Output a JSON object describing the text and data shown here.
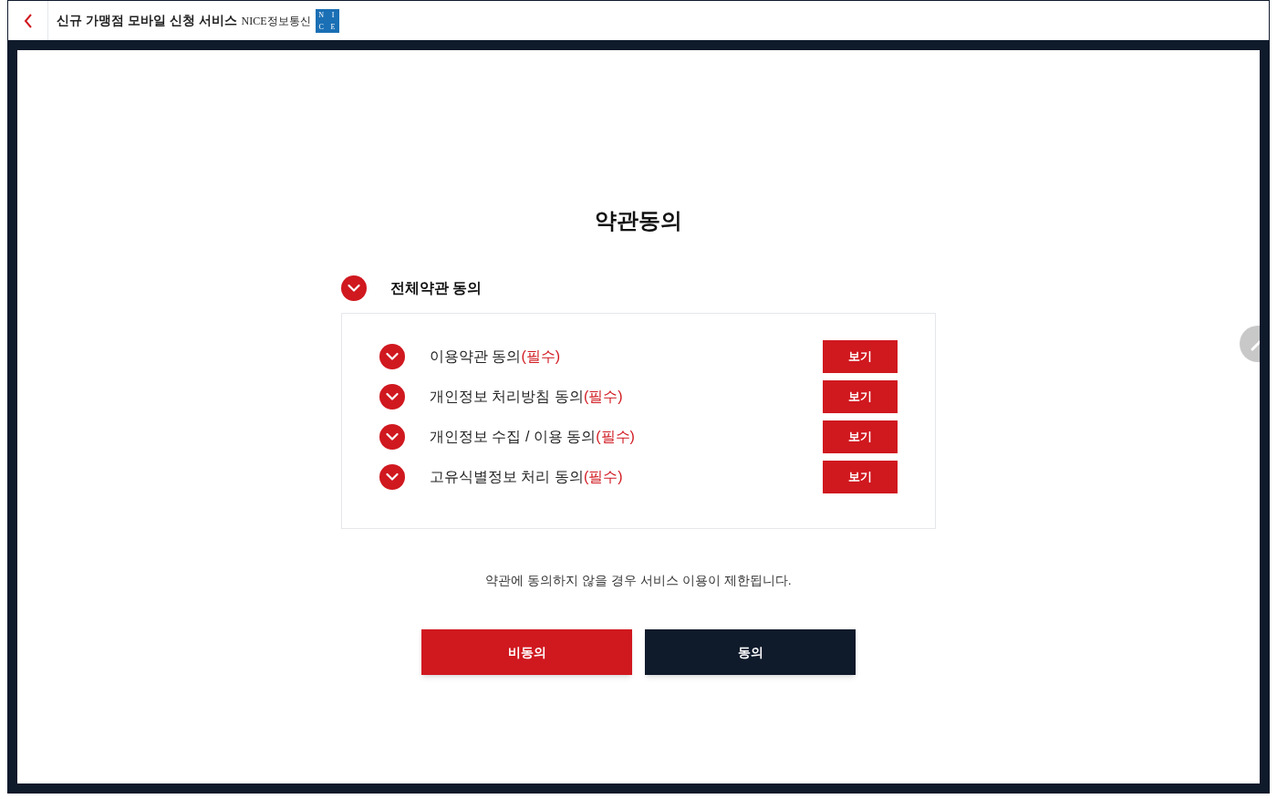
{
  "header": {
    "title": "신규 가맹점 모바일 신청 서비스",
    "brand": "NICE정보통신",
    "logo_letters": [
      "N",
      "I",
      "C",
      "E"
    ]
  },
  "heading": "약관동의",
  "all_agree": {
    "label": "전체약관 동의",
    "checked": true
  },
  "terms": [
    {
      "label": "이용약관 동의",
      "tag": "(필수)",
      "checked": true,
      "button": "보기"
    },
    {
      "label": "개인정보 처리방침 동의",
      "tag": "(필수)",
      "checked": true,
      "button": "보기"
    },
    {
      "label": "개인정보 수집 / 이용 동의",
      "tag": "(필수)",
      "checked": true,
      "button": "보기"
    },
    {
      "label": "고유식별정보 처리 동의",
      "tag": "(필수)",
      "checked": true,
      "button": "보기"
    }
  ],
  "notice": "약관에 동의하지 않을 경우 서비스 이용이 제한됩니다.",
  "buttons": [
    {
      "label": "비동의",
      "kind": "decline"
    },
    {
      "label": "동의",
      "kind": "accept"
    }
  ]
}
